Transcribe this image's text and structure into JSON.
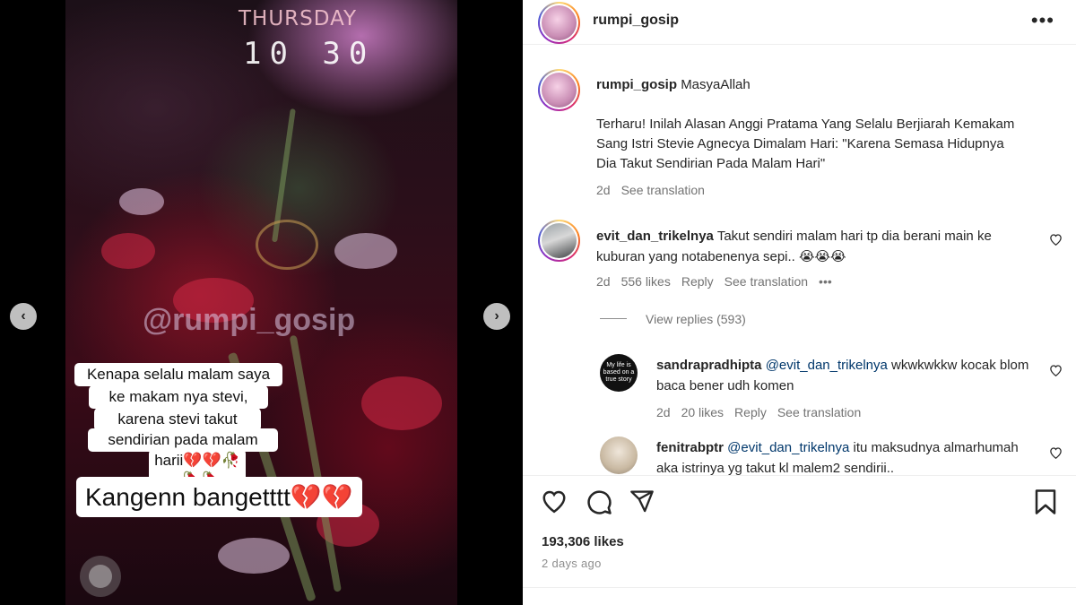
{
  "media": {
    "story_day": "THURSDAY",
    "story_time": "10 30",
    "watermark": "@rumpi_gosip",
    "caption_lines": [
      "Kenapa selalu malam saya",
      "ke makam nya stevi,",
      "karena stevi takut",
      "sendirian pada malam",
      "harii💔💔🥀🥀🥀"
    ],
    "caption_big": "Kangenn bangetttt💔💔",
    "prev_icon": "‹",
    "next_icon": "›"
  },
  "header": {
    "username": "rumpi_gosip",
    "more_icon": "•••"
  },
  "post_caption": {
    "username": "rumpi_gosip",
    "text": "MasyaAllah",
    "body": "Terharu! Inilah Alasan Anggi Pratama Yang Selalu Berjiarah Kemakam Sang Istri Stevie Agnecya Dimalam Hari: \"Karena Semasa Hidupnya Dia Takut Sendirian Pada Malam Hari\"",
    "age": "2d",
    "see_translation": "See translation"
  },
  "comments": [
    {
      "username": "evit_dan_trikelnya",
      "text": "Takut sendiri malam hari tp dia berani main ke kuburan yang notabenenya sepi.. 😭😭😭",
      "age": "2d",
      "likes": "556 likes",
      "reply": "Reply",
      "see_translation": "See translation",
      "more": "•••",
      "view_replies": "View replies (593)"
    }
  ],
  "replies": [
    {
      "username": "sandrapradhipta",
      "mention": "@evit_dan_trikelnya",
      "text": "wkwkwkkw kocak blom baca bener udh komen",
      "age": "2d",
      "likes": "20 likes",
      "reply": "Reply",
      "see_translation": "See translation",
      "avatar_text": "My life is based on a true story"
    },
    {
      "username": "fenitrabptr",
      "mention": "@evit_dan_trikelnya",
      "text": "itu maksudnya almarhumah aka istrinya yg takut kl malem2 sendirii.."
    }
  ],
  "footer": {
    "likes": "193,306 likes",
    "time_ago": "2 days ago"
  },
  "icons": {
    "heart": "heart-icon",
    "comment": "comment-icon",
    "share": "share-icon",
    "bookmark": "bookmark-icon"
  }
}
